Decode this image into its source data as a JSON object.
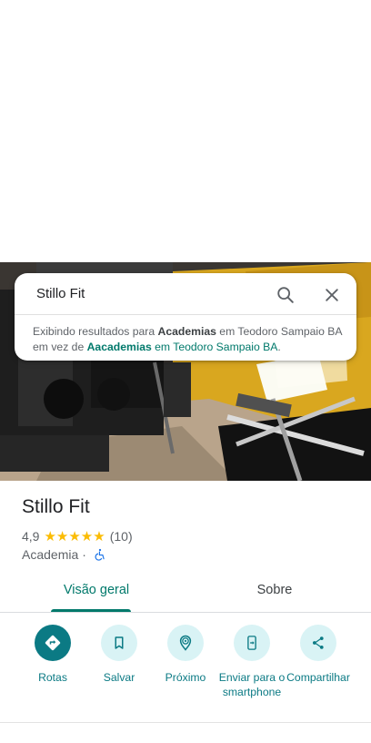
{
  "search": {
    "query": "Stillo Fit",
    "notice_prefix": "Exibindo resultados para ",
    "notice_bold": "Academias",
    "notice_mid": " em Teodoro Sampaio BA em vez de ",
    "notice_link_bold": "Aacademias",
    "notice_link_rest": " em Teodoro Sampaio BA",
    "notice_end": "."
  },
  "place": {
    "name": "Stillo Fit",
    "rating": "4,9",
    "stars": "★★★★★",
    "review_count": "(10)",
    "category": "Academia",
    "separator": "·"
  },
  "tabs": [
    {
      "label": "Visão geral",
      "selected": true
    },
    {
      "label": "Sobre",
      "selected": false
    }
  ],
  "actions": [
    {
      "label": "Rotas",
      "icon": "directions-icon"
    },
    {
      "label": "Salvar",
      "icon": "bookmark-icon"
    },
    {
      "label": "Próximo",
      "icon": "nearby-icon"
    },
    {
      "label": "Enviar para o smartphone",
      "icon": "send-to-phone-icon"
    },
    {
      "label": "Compartilhar",
      "icon": "share-icon"
    }
  ],
  "colors": {
    "accent": "#0b7a84",
    "star": "#fbbc04",
    "action_bg": "#d9f3f5"
  }
}
